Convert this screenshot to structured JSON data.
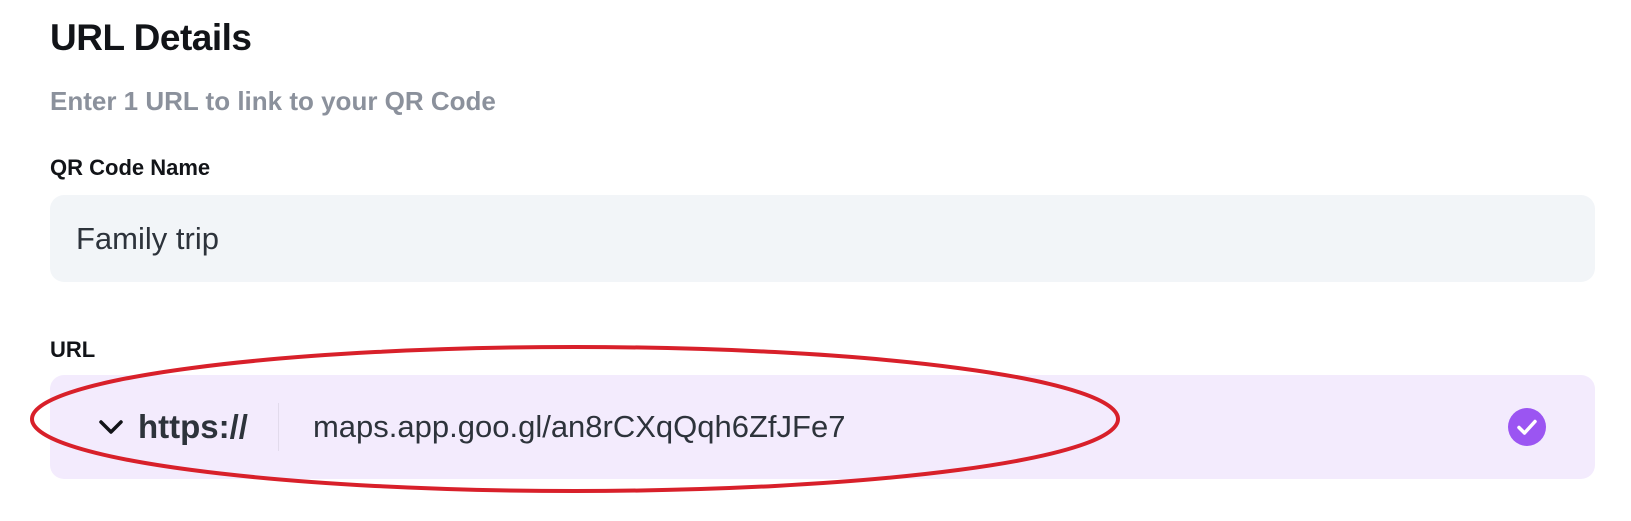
{
  "section": {
    "title": "URL Details",
    "subtitle": "Enter 1 URL to link to your QR Code"
  },
  "qr_name": {
    "label": "QR Code Name",
    "value": "Family trip"
  },
  "url": {
    "label": "URL",
    "protocol": "https://",
    "value": "maps.app.goo.gl/an8rCXqQqh6ZfJFe7",
    "valid": true
  },
  "icons": {
    "protocol_toggle": "chevron-down-icon",
    "validation": "check-circle-icon"
  },
  "colors": {
    "accent": "#9b55f2",
    "url_background": "#f3ebfd",
    "input_background": "#f2f5f8",
    "annotation": "#d8202a"
  }
}
